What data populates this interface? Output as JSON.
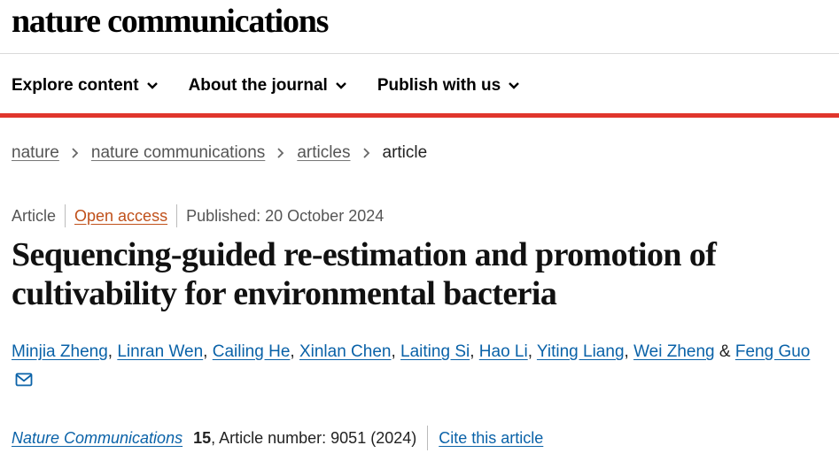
{
  "site": {
    "brand": "nature communications"
  },
  "nav": {
    "items": [
      {
        "label": "Explore content",
        "icon": "chevron-down-icon"
      },
      {
        "label": "About the journal",
        "icon": "chevron-down-icon"
      },
      {
        "label": "Publish with us",
        "icon": "chevron-down-icon"
      }
    ]
  },
  "breadcrumb": {
    "items": [
      {
        "label": "nature"
      },
      {
        "label": "nature communications"
      },
      {
        "label": "articles"
      }
    ],
    "current": "article",
    "separator_icon": "chevron-right-icon"
  },
  "article": {
    "type": "Article",
    "access": "Open access",
    "published": "Published: 20 October 2024",
    "title": "Sequencing-guided re-estimation and promotion of cultivability for environmental bacteria",
    "authors": [
      "Minjia Zheng",
      "Linran Wen",
      "Cailing He",
      "Xinlan Chen",
      "Laiting Si",
      "Hao Li",
      "Yiting Liang",
      "Wei Zheng",
      "Feng Guo"
    ],
    "author_separator": ",",
    "author_last_separator": "&",
    "contact_icon": "mail-icon"
  },
  "citation": {
    "journal": "Nature Communications",
    "volume": "15",
    "details": ", Article number: 9051 (2024)",
    "cite_label": "Cite this article"
  },
  "colors": {
    "accent_red": "#e0362c",
    "link_blue": "#0a62a8",
    "open_access_orange": "#c0501a"
  }
}
